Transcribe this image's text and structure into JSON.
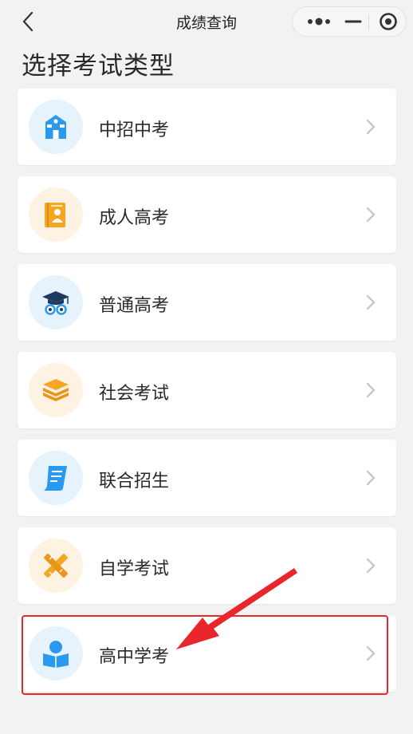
{
  "nav": {
    "title": "成绩查询",
    "back_icon": "chevron-left-icon",
    "capsule_icons": [
      "more-dots-icon",
      "minus-icon",
      "target-close-icon"
    ]
  },
  "heading": "选择考试类型",
  "items": [
    {
      "label": "中招中考",
      "icon": "school-building-icon",
      "tone": "blue"
    },
    {
      "label": "成人高考",
      "icon": "book-person-icon",
      "tone": "orange"
    },
    {
      "label": "普通高考",
      "icon": "graduation-cap-icon",
      "tone": "blue"
    },
    {
      "label": "社会考试",
      "icon": "layers-icon",
      "tone": "orange"
    },
    {
      "label": "联合招生",
      "icon": "document-scroll-icon",
      "tone": "blue"
    },
    {
      "label": "自学考试",
      "icon": "pencil-ruler-icon",
      "tone": "orange"
    },
    {
      "label": "高中学考",
      "icon": "student-reading-icon",
      "tone": "blue"
    }
  ],
  "colors": {
    "blue_icon": "#2a9af0",
    "orange_icon": "#f5a623",
    "highlight": "#e8262b"
  },
  "annotation": {
    "highlighted_item": "高中学考",
    "marker": "red-arrow"
  }
}
